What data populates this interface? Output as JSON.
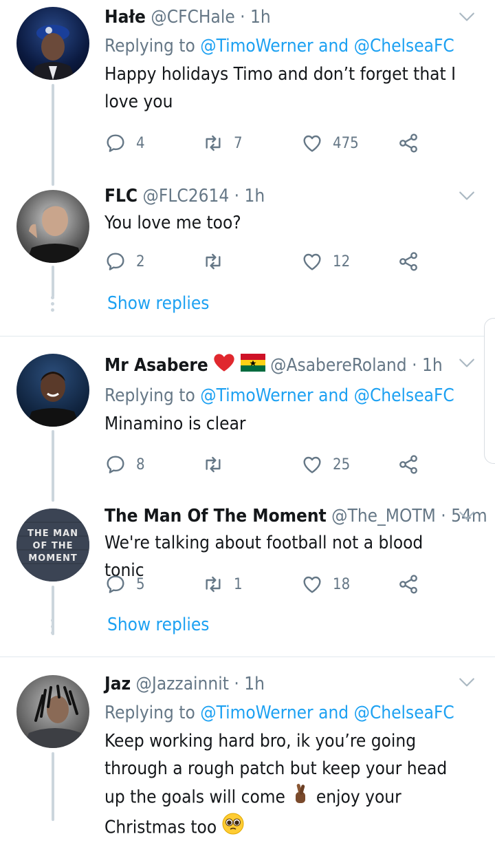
{
  "tweets": [
    {
      "name": "Hałe",
      "handle": "@CFCHale",
      "time": "1h",
      "replying_prefix": "Replying to",
      "mention1": "@TimoWerner",
      "and": "and",
      "mention2": "@ChelseaFC",
      "text": "Happy holidays Timo and don’t forget that I love you",
      "replies": "4",
      "retweets": "7",
      "likes": "475"
    },
    {
      "name": "FLC",
      "handle": "@FLC2614",
      "time": "1h",
      "text": "You love me too?",
      "replies": "2",
      "retweets": "",
      "likes": "12",
      "show_replies": "Show replies"
    },
    {
      "name": "Mr Asabere",
      "handle": "@AsabereRoland",
      "time": "1h",
      "replying_prefix": "Replying to",
      "mention1": "@TimoWerner",
      "and": "and",
      "mention2": "@ChelseaFC",
      "text": "Minamino is clear",
      "replies": "8",
      "retweets": "",
      "likes": "25"
    },
    {
      "name": "The Man Of The Moment",
      "handle": "@The_MOTM",
      "time": "54m",
      "avatar_text": "THE MAN OF THE MOMENT",
      "text": "We're talking about football not a blood tonic",
      "replies": "5",
      "retweets": "1",
      "likes": "18",
      "show_replies": "Show replies"
    },
    {
      "name": "Jaz",
      "handle": "@Jazzainnit",
      "time": "1h",
      "replying_prefix": "Replying to",
      "mention1": "@TimoWerner",
      "and": "and",
      "mention2": "@ChelseaFC",
      "text_part1": "Keep working hard bro, ik you’re going through a rough patch but keep your head up the goals will come",
      "text_part2": "enjoy your Christmas too"
    }
  ],
  "separator": "·",
  "colors": {
    "accent": "#1da1f2",
    "muted": "#657786",
    "line": "#ccd6dd"
  },
  "icons": [
    "reply-icon",
    "retweet-icon",
    "like-icon",
    "share-icon",
    "chevron-down-icon"
  ]
}
